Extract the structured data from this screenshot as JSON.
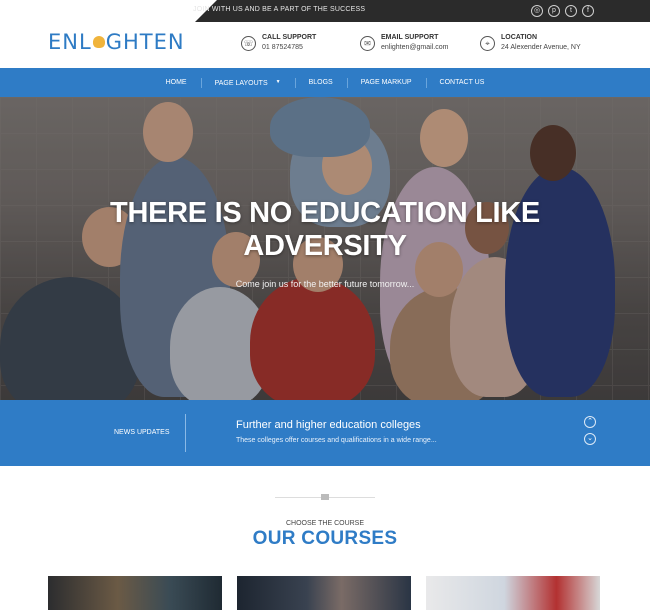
{
  "topbar": {
    "tagline": "JOIN WITH US AND BE A PART OF THE SUCCESS",
    "social": [
      {
        "icon": "instagram-icon",
        "glyph": "◎"
      },
      {
        "icon": "pinterest-icon",
        "glyph": "p"
      },
      {
        "icon": "twitter-icon",
        "glyph": "t"
      },
      {
        "icon": "facebook-icon",
        "glyph": "f"
      }
    ]
  },
  "header": {
    "logo_left": "ENL",
    "logo_right": "GHTEN",
    "call": {
      "title": "CALL SUPPORT",
      "value": "01 87524785",
      "icon": "phone-icon"
    },
    "email": {
      "title": "EMAIL SUPPORT",
      "value": "enlighten@gmail.com",
      "icon": "mail-icon"
    },
    "location": {
      "title": "LOCATION",
      "value": "24 Alexender Avenue, NY",
      "icon": "location-pin-icon"
    }
  },
  "nav": {
    "items": [
      "HOME",
      "PAGE LAYOUTS",
      "BLOGS",
      "PAGE MARKUP",
      "CONTACT US"
    ]
  },
  "hero": {
    "title_line1": "THERE IS NO EDUCATION LIKE",
    "title_line2": "ADVERSITY",
    "subtitle": "Come join us for the better future tomorrow..."
  },
  "news": {
    "label": "NEWS UPDATES",
    "headline": "Further and higher education colleges",
    "text": "These colleges offer courses and qualifications in a wide range...",
    "up": "⌃",
    "down": "⌄"
  },
  "courses": {
    "kicker": "CHOOSE THE COURSE",
    "title": "OUR COURSES"
  },
  "colors": {
    "brand_blue": "#2f7cc6",
    "topbar": "#2b2b2b",
    "accent_yellow": "#f0b43c"
  }
}
